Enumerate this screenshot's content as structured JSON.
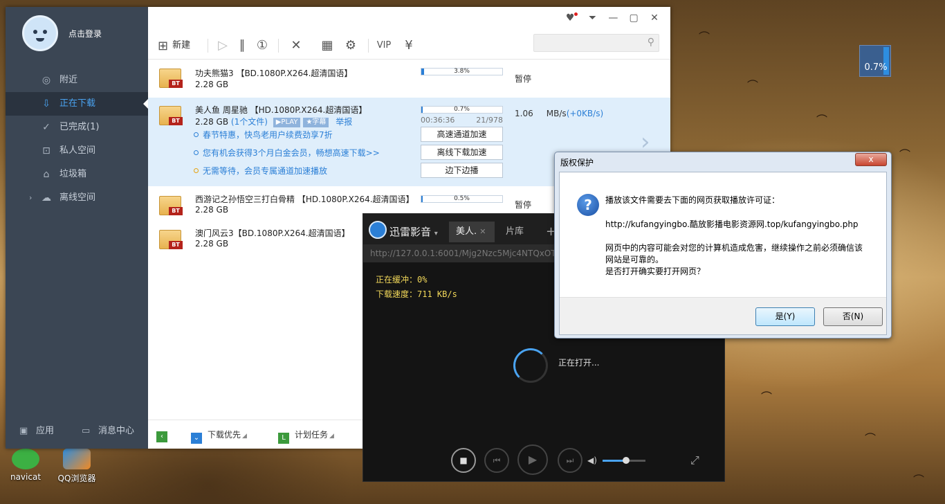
{
  "desktop": {
    "icons": [
      {
        "label": "navicat"
      },
      {
        "label": "QQ浏览器"
      }
    ],
    "float_widget": {
      "value": "0.7%"
    }
  },
  "thunder": {
    "user": {
      "login_text": "点击登录"
    },
    "nav": [
      {
        "label": "附近",
        "icon": "location-icon"
      },
      {
        "label": "正在下载",
        "icon": "download-icon",
        "active": true
      },
      {
        "label": "已完成(1)",
        "icon": "check-icon"
      },
      {
        "label": "私人空间",
        "icon": "lock-icon"
      },
      {
        "label": "垃圾箱",
        "icon": "trash-icon"
      },
      {
        "label": "离线空间",
        "icon": "cloud-icon"
      }
    ],
    "sidebar_bottom": {
      "apps_label": "应用",
      "messages_label": "消息中心"
    },
    "toolbar": {
      "new_label": "新建",
      "search_placeholder": ""
    },
    "downloads": [
      {
        "name": "功夫熊猫3 【BD.1080P.X264.超清国语】",
        "size": "2.28 GB",
        "progress_text": "3.8%",
        "progress": 3.8,
        "status": "暂停"
      },
      {
        "name": "美人鱼 周星驰 【HD.1080P.X264.超清国语】",
        "size": "2.28 GB",
        "file_count": "(1个文件)",
        "tag_play": "▶PLAY",
        "tag_subtitle": "★字幕",
        "report": "举报",
        "progress_text": "0.7%",
        "progress": 0.7,
        "elapsed": "00:36:36",
        "pieces": "21/978",
        "speed_value": "1.06",
        "speed_unit": "MB/s",
        "speed_extra": "(+0KB/s)",
        "promos": [
          "春节特惠，快鸟老用户续费劲享7折",
          "您有机会获得3个月白金会员，畅想高速下载>>",
          "无需等待，会员专属通道加速播放"
        ],
        "buttons": [
          "高速通道加速",
          "离线下载加速",
          "边下边播"
        ]
      },
      {
        "name": "西游记之孙悟空三打白骨精 【HD.1080P.X264.超清国语】",
        "size": "2.28 GB",
        "progress_text": "0.5%",
        "progress": 0.5,
        "status": "暂停"
      },
      {
        "name": "澳门风云3【BD.1080P.X264.超清国语】",
        "size": "2.28 GB"
      }
    ],
    "bottom_bar": {
      "priority_label": "下载优先",
      "plan_label": "计划任务"
    }
  },
  "player": {
    "title": "迅雷影音",
    "tabs": [
      "美人.",
      "片库"
    ],
    "url": "http://127.0.0.1:6001/Mjg2Nzc5Mjc4NTQxOTY",
    "buffer_line": "正在缓冲：0%",
    "speed_line": "下载速度：711 KB/s",
    "opening_text": "正在打开...",
    "volume": 0.55
  },
  "dialog": {
    "title": "版权保护",
    "close_glyph": "x",
    "line1": "播放该文件需要去下面的网页获取播放许可证：",
    "url": "http://kufangyingbo.酷放影播电影资源网.top/kufangyingbo.php",
    "warn1": "网页中的内容可能会对您的计算机造成危害，继续操作之前必须确信该",
    "warn2": "网站是可靠的。",
    "question": "是否打开确实要打开网页？",
    "yes_label": "是(Y)",
    "no_label": "否(N)"
  }
}
